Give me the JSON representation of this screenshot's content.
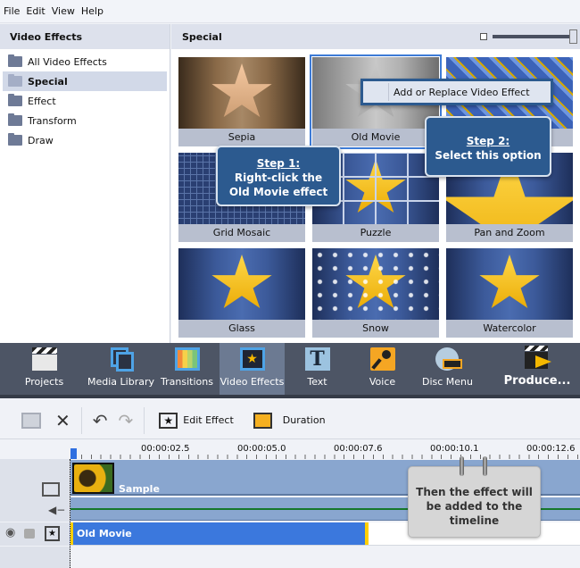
{
  "menu": [
    "File",
    "Edit",
    "View",
    "Help"
  ],
  "left_panel": {
    "title": "Video Effects",
    "items": [
      {
        "label": "All Video Effects",
        "selected": false
      },
      {
        "label": "Special",
        "selected": true
      },
      {
        "label": "Effect",
        "selected": false
      },
      {
        "label": "Transform",
        "selected": false
      },
      {
        "label": "Draw",
        "selected": false
      }
    ]
  },
  "right_panel": {
    "title": "Special",
    "zoom_slider_value": 1.0,
    "tiles": [
      {
        "label": "Sepia"
      },
      {
        "label": "Old Movie",
        "selected": true
      },
      {
        "label": ""
      },
      {
        "label": "Grid Mosaic"
      },
      {
        "label": "Puzzle"
      },
      {
        "label": "Pan and Zoom"
      },
      {
        "label": "Glass"
      },
      {
        "label": "Snow"
      },
      {
        "label": "Watercolor"
      }
    ]
  },
  "context_menu": {
    "item": "Add or Replace Video Effect"
  },
  "callouts": {
    "step1_title": "Step 1:",
    "step1_text": "Right-click the Old Movie effect",
    "step2_title": "Step 2:",
    "step2_text": "Select this option",
    "note": "Then the effect will be added to the timeline"
  },
  "tabs": [
    {
      "label": "Projects",
      "icon": "clapperboard-icon"
    },
    {
      "label": "Media Library",
      "icon": "film-frames-icon"
    },
    {
      "label": "Transitions",
      "icon": "transitions-icon"
    },
    {
      "label": "Video Effects",
      "icon": "star-film-icon",
      "active": true
    },
    {
      "label": "Text",
      "icon": "text-t-icon"
    },
    {
      "label": "Voice",
      "icon": "microphone-icon"
    },
    {
      "label": "Disc Menu",
      "icon": "disc-icon"
    },
    {
      "label": "Produce...",
      "icon": "produce-clapper-icon"
    }
  ],
  "toolbar": {
    "edit_effect": "Edit Effect",
    "duration": "Duration"
  },
  "ruler": {
    "labels": [
      "00:00:02.5",
      "00:00:05.0",
      "00:00:07.6",
      "00:00:10.1",
      "00:00:12.6"
    ]
  },
  "timeline": {
    "video_clip": "Sample",
    "effect_clip": "Old Movie"
  },
  "colors": {
    "accent": "#3b78dd",
    "callout": "#2c5a8f",
    "tab_bar": "#4d5565"
  }
}
